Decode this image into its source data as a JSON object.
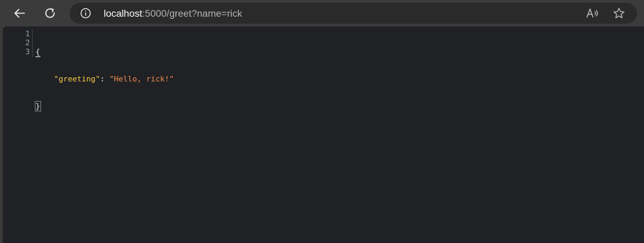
{
  "toolbar": {
    "back_icon": "arrow-left-icon",
    "reload_icon": "reload-icon"
  },
  "address_bar": {
    "host": "localhost",
    "path": ":5000/greet?name=rick",
    "info_icon": "info-icon",
    "read_aloud_icon": "read-aloud-icon",
    "favorite_icon": "star-icon"
  },
  "json_viewer": {
    "line_numbers": [
      "1",
      "2",
      "3"
    ],
    "open_brace": "{",
    "close_brace": "}",
    "key": "\"greeting\"",
    "separator": ": ",
    "value": "\"Hello, rick!\""
  },
  "colors": {
    "key": "#f2c94c",
    "string_value": "#f28b52",
    "background": "#202124",
    "toolbar": "#3b3b3b"
  }
}
